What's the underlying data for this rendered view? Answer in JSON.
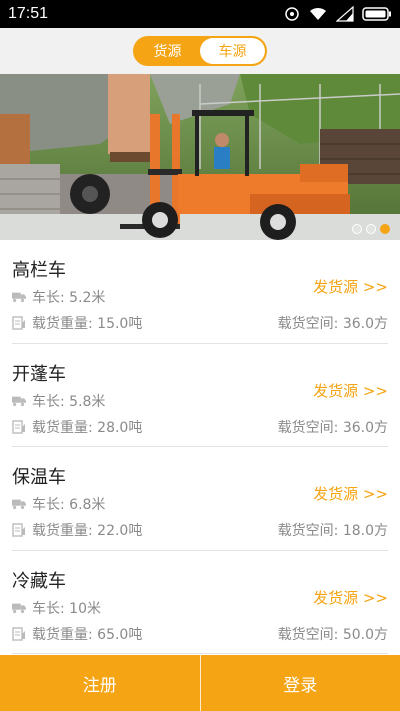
{
  "status_bar": {
    "time": "17:51"
  },
  "tabs": [
    {
      "label": "货源",
      "active": true
    },
    {
      "label": "车源",
      "active": false
    }
  ],
  "colors": {
    "accent": "#f5a414",
    "text": "#222222",
    "muted": "#8a8a8a"
  },
  "banner": {
    "description_icon": "forklift-photo",
    "pages": 3,
    "current_page": 3
  },
  "vehicles": [
    {
      "name": "高栏车",
      "length": "车长: 5.2米",
      "weight": "载货重量: 15.0吨",
      "space": "载货空间: 36.0方",
      "action": "发货源 >>"
    },
    {
      "name": "开蓬车",
      "length": "车长: 5.8米",
      "weight": "载货重量: 28.0吨",
      "space": "载货空间: 36.0方",
      "action": "发货源 >>"
    },
    {
      "name": "保温车",
      "length": "车长: 6.8米",
      "weight": "载货重量: 22.0吨",
      "space": "载货空间: 18.0方",
      "action": "发货源 >>"
    },
    {
      "name": "冷藏车",
      "length": "车长: 10米",
      "weight": "载货重量: 65.0吨",
      "space": "载货空间: 50.0方",
      "action": "发货源 >>"
    }
  ],
  "bottom": {
    "register": "注册",
    "login": "登录"
  }
}
